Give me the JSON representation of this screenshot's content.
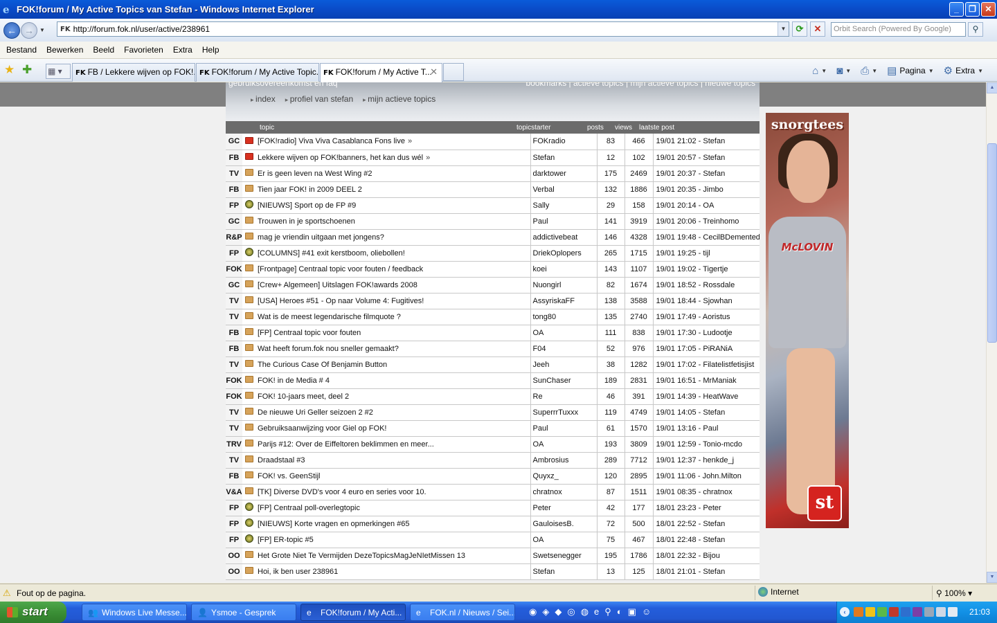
{
  "window": {
    "title": "FOK!forum / My Active Topics van Stefan - Windows Internet Explorer"
  },
  "address": {
    "url": "http://forum.fok.nl/user/active/238961",
    "search_placeholder": "Orbit Search (Powered By Google)"
  },
  "menu": [
    "Bestand",
    "Bewerken",
    "Beeld",
    "Favorieten",
    "Extra",
    "Help"
  ],
  "tabs": [
    {
      "label": "FB / Lekkere wijven op FOK!..."
    },
    {
      "label": "FOK!forum / My Active Topic..."
    },
    {
      "label": "FOK!forum / My Active T..."
    }
  ],
  "commandbar": {
    "page_label": "Pagina",
    "tools_label": "Extra"
  },
  "header": {
    "top_left": "gebruiksovereenkomst en faq",
    "top_right": "bookmarks | actieve topics | mijn actieve topics | nieuwe topics",
    "crumbs": [
      "index",
      "profiel van stefan",
      "mijn actieve topics"
    ]
  },
  "columns": {
    "topic": "topic",
    "starter": "topicstarter",
    "posts": "posts",
    "views": "views",
    "last": "laatste post"
  },
  "topics": [
    {
      "cat": "GC",
      "icon": "hot",
      "title": "[FOK!radio] Viva Viva Casablanca Fons live",
      "more": "»",
      "starter": "FOKradio",
      "posts": "83",
      "views": "466",
      "last": "19/01 21:02 - Stefan"
    },
    {
      "cat": "FB",
      "icon": "hot",
      "title": "Lekkere wijven op FOK!banners, het kan dus wél",
      "more": "»",
      "starter": "Stefan",
      "posts": "12",
      "views": "102",
      "last": "19/01 20:57 - Stefan"
    },
    {
      "cat": "TV",
      "icon": "folder",
      "title": "Er is geen leven na West Wing #2",
      "more": "",
      "starter": "darktower",
      "posts": "175",
      "views": "2469",
      "last": "19/01 20:37 - Stefan"
    },
    {
      "cat": "FB",
      "icon": "folder",
      "title": "Tien jaar FOK! in 2009 DEEL 2",
      "more": "",
      "starter": "Verbal",
      "posts": "132",
      "views": "1886",
      "last": "19/01 20:35 - Jimbo"
    },
    {
      "cat": "FP",
      "icon": "fp",
      "title": "[NIEUWS] Sport op de FP #9",
      "more": "",
      "starter": "Sally",
      "posts": "29",
      "views": "158",
      "last": "19/01 20:14 - OA"
    },
    {
      "cat": "GC",
      "icon": "folder",
      "title": "Trouwen in je sportschoenen",
      "more": "",
      "starter": "Paul",
      "posts": "141",
      "views": "3919",
      "last": "19/01 20:06 - Treinhomo"
    },
    {
      "cat": "R&P",
      "icon": "folder",
      "title": "mag je vriendin uitgaan met jongens?",
      "more": "",
      "starter": "addictivebeat",
      "posts": "146",
      "views": "4328",
      "last": "19/01 19:48 - CecilBDemented"
    },
    {
      "cat": "FP",
      "icon": "fp",
      "title": "[COLUMNS] #41 exit kerstboom, oliebollen!",
      "more": "",
      "starter": "DriekOplopers",
      "posts": "265",
      "views": "1715",
      "last": "19/01 19:25 - tijl"
    },
    {
      "cat": "FOK",
      "icon": "folder",
      "title": "[Frontpage] Centraal topic voor fouten / feedback",
      "more": "",
      "starter": "koei",
      "posts": "143",
      "views": "1107",
      "last": "19/01 19:02 - Tigertje"
    },
    {
      "cat": "GC",
      "icon": "folder",
      "title": "[Crew+ Algemeen] Uitslagen FOK!awards 2008",
      "more": "",
      "starter": "Nuongirl",
      "posts": "82",
      "views": "1674",
      "last": "19/01 18:52 - Rossdale"
    },
    {
      "cat": "TV",
      "icon": "folder",
      "title": "[USA] Heroes #51 - Op naar Volume 4: Fugitives!",
      "more": "",
      "starter": "AssyriskaFF",
      "posts": "138",
      "views": "3588",
      "last": "19/01 18:44 - Sjowhan"
    },
    {
      "cat": "TV",
      "icon": "folder",
      "title": "Wat is de meest legendarische filmquote ?",
      "more": "",
      "starter": "tong80",
      "posts": "135",
      "views": "2740",
      "last": "19/01 17:49 - Aoristus"
    },
    {
      "cat": "FB",
      "icon": "folder",
      "title": "[FP] Centraal topic voor fouten",
      "more": "",
      "starter": "OA",
      "posts": "111",
      "views": "838",
      "last": "19/01 17:30 - Ludootje"
    },
    {
      "cat": "FB",
      "icon": "folder",
      "title": "Wat heeft forum.fok nou sneller gemaakt?",
      "more": "",
      "starter": "F04",
      "posts": "52",
      "views": "976",
      "last": "19/01 17:05 - PiRANiA"
    },
    {
      "cat": "TV",
      "icon": "folder",
      "title": "The Curious Case Of Benjamin Button",
      "more": "",
      "starter": "Jeeh",
      "posts": "38",
      "views": "1282",
      "last": "19/01 17:02 - Filatelistfetisjist"
    },
    {
      "cat": "FOK",
      "icon": "folder",
      "title": "FOK! in de Media # 4",
      "more": "",
      "starter": "SunChaser",
      "posts": "189",
      "views": "2831",
      "last": "19/01 16:51 - MrManiak"
    },
    {
      "cat": "FOK",
      "icon": "folder",
      "title": "FOK! 10-jaars meet, deel 2",
      "more": "",
      "starter": "Re",
      "posts": "46",
      "views": "391",
      "last": "19/01 14:39 - HeatWave"
    },
    {
      "cat": "TV",
      "icon": "folder",
      "title": "De nieuwe Uri Geller seizoen 2 #2",
      "more": "",
      "starter": "SuperrrTuxxx",
      "posts": "119",
      "views": "4749",
      "last": "19/01 14:05 - Stefan"
    },
    {
      "cat": "TV",
      "icon": "folder",
      "title": "Gebruiksaanwijzing voor Giel op FOK!",
      "more": "",
      "starter": "Paul",
      "posts": "61",
      "views": "1570",
      "last": "19/01 13:16 - Paul"
    },
    {
      "cat": "TRV",
      "icon": "folder",
      "title": "Parijs #12: Over de Eiffeltoren beklimmen en meer...",
      "more": "",
      "starter": "OA",
      "posts": "193",
      "views": "3809",
      "last": "19/01 12:59 - Tonio-mcdo"
    },
    {
      "cat": "TV",
      "icon": "folder",
      "title": "Draadstaal #3",
      "more": "",
      "starter": "Ambrosius",
      "posts": "289",
      "views": "7712",
      "last": "19/01 12:37 - henkde_j"
    },
    {
      "cat": "FB",
      "icon": "folder",
      "title": "FOK! vs. GeenStijl",
      "more": "",
      "starter": "Quyxz_",
      "posts": "120",
      "views": "2895",
      "last": "19/01 11:06 - John.Milton"
    },
    {
      "cat": "V&A",
      "icon": "folder",
      "title": "[TK] Diverse DVD's voor 4 euro en series voor 10.",
      "more": "",
      "starter": "chratnox",
      "posts": "87",
      "views": "1511",
      "last": "19/01 08:35 - chratnox"
    },
    {
      "cat": "FP",
      "icon": "fp",
      "title": "[FP] Centraal poll-overlegtopic",
      "more": "",
      "starter": "Peter",
      "posts": "42",
      "views": "177",
      "last": "18/01 23:23 - Peter"
    },
    {
      "cat": "FP",
      "icon": "fp",
      "title": "[NIEUWS] Korte vragen en opmerkingen #65",
      "more": "",
      "starter": "GauloisesB.",
      "posts": "72",
      "views": "500",
      "last": "18/01 22:52 - Stefan"
    },
    {
      "cat": "FP",
      "icon": "fp",
      "title": "[FP] ER-topic #5",
      "more": "",
      "starter": "OA",
      "posts": "75",
      "views": "467",
      "last": "18/01 22:48 - Stefan"
    },
    {
      "cat": "OO",
      "icon": "folder",
      "title": "Het Grote Niet Te Vermijden DezeTopicsMagJeNIetMissen 13",
      "more": "",
      "starter": "Swetsenegger",
      "posts": "195",
      "views": "1786",
      "last": "18/01 22:32 - Bijou"
    },
    {
      "cat": "OO",
      "icon": "folder",
      "title": "Hoi, ik ben user 238961",
      "more": "",
      "starter": "Stefan",
      "posts": "13",
      "views": "125",
      "last": "18/01 21:01 - Stefan"
    }
  ],
  "ad": {
    "brand": "snorgtees",
    "shirt_text": "McLOVIN",
    "logo": "st"
  },
  "status": {
    "message": "Fout op de pagina.",
    "zone": "Internet",
    "zoom": "100%"
  },
  "taskbar": {
    "start": "start",
    "tasks": [
      "Windows Live Messe...",
      "Ysmoe - Gesprek",
      "FOK!forum / My Acti...",
      "FOK.nl / Nieuws / Sei..."
    ],
    "clock": "21:03"
  }
}
